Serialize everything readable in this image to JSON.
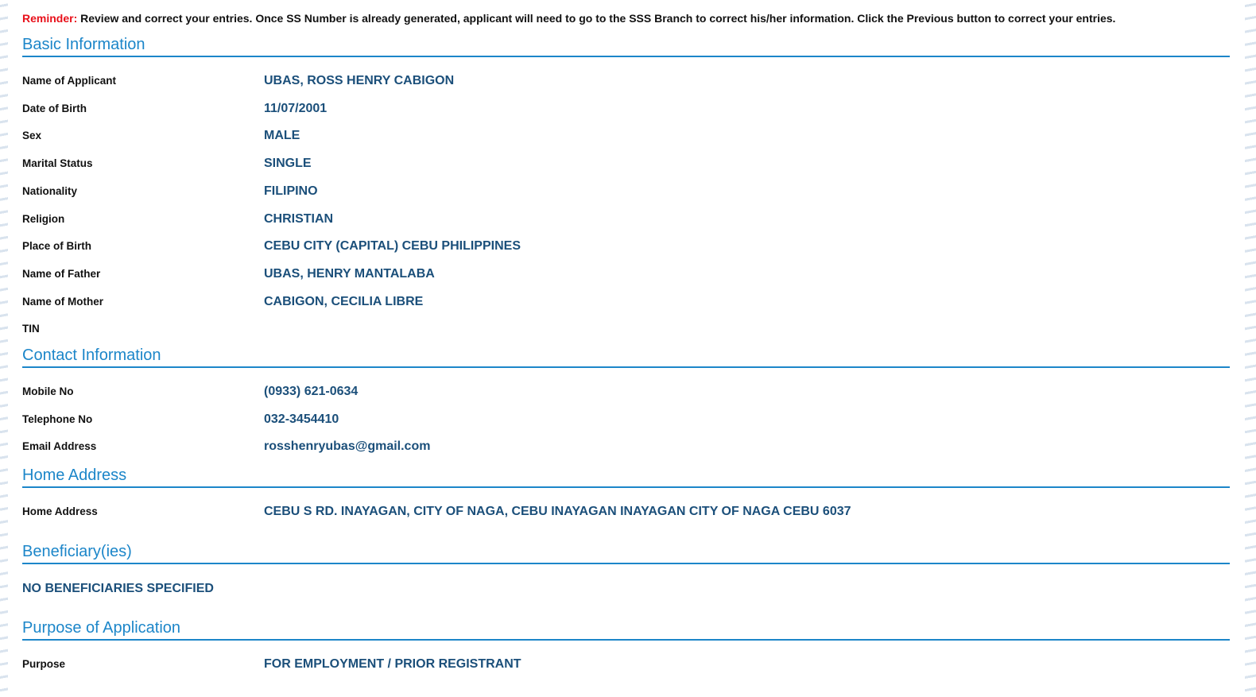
{
  "reminder": {
    "label": "Reminder:",
    "text": " Review and correct your entries. Once SS Number is already generated, applicant will need to go to the SSS Branch to correct his/her information. Click the Previous button to correct your entries."
  },
  "basic_information": {
    "title": "Basic Information",
    "fields": [
      {
        "label": "Name of Applicant",
        "value": "UBAS, ROSS HENRY CABIGON"
      },
      {
        "label": "Date of Birth",
        "value": "11/07/2001"
      },
      {
        "label": "Sex",
        "value": "MALE"
      },
      {
        "label": "Marital Status",
        "value": "SINGLE"
      },
      {
        "label": "Nationality",
        "value": "FILIPINO"
      },
      {
        "label": "Religion",
        "value": "CHRISTIAN"
      },
      {
        "label": "Place of Birth",
        "value": "CEBU CITY (CAPITAL) CEBU PHILIPPINES"
      },
      {
        "label": "Name of Father",
        "value": "UBAS, HENRY MANTALABA"
      },
      {
        "label": "Name of Mother",
        "value": "CABIGON, CECILIA LIBRE"
      },
      {
        "label": "TIN",
        "value": ""
      }
    ]
  },
  "contact_information": {
    "title": "Contact Information",
    "fields": [
      {
        "label": "Mobile No",
        "value": "(0933) 621-0634"
      },
      {
        "label": "Telephone No",
        "value": "032-3454410"
      },
      {
        "label": "Email Address",
        "value": "rosshenryubas@gmail.com"
      }
    ]
  },
  "home_address": {
    "title": "Home Address",
    "fields": [
      {
        "label": "Home Address",
        "value": "CEBU S RD. INAYAGAN, CITY OF NAGA, CEBU INAYAGAN INAYAGAN CITY OF NAGA CEBU 6037"
      }
    ]
  },
  "beneficiaries": {
    "title": "Beneficiary(ies)",
    "empty_text": "NO BENEFICIARIES SPECIFIED"
  },
  "purpose": {
    "title": "Purpose of Application",
    "fields": [
      {
        "label": "Purpose",
        "value": "FOR EMPLOYMENT / PRIOR REGISTRANT"
      }
    ]
  }
}
